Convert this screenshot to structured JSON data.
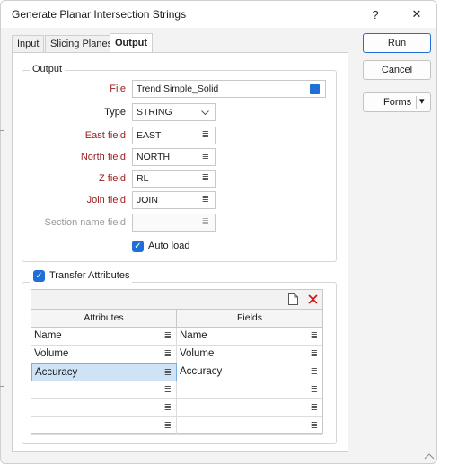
{
  "window": {
    "title": "Generate Planar Intersection Strings",
    "help": "?",
    "close": "✕"
  },
  "tabs": [
    {
      "label": "Input"
    },
    {
      "label": "Slicing Planes"
    },
    {
      "label": "Output"
    }
  ],
  "output": {
    "group_label": "Output",
    "file": {
      "label": "File",
      "value": "Trend Simple_Solid"
    },
    "type": {
      "label": "Type",
      "value": "STRING"
    },
    "east": {
      "label": "East field",
      "value": "EAST"
    },
    "north": {
      "label": "North field",
      "value": "NORTH"
    },
    "z": {
      "label": "Z field",
      "value": "RL"
    },
    "join": {
      "label": "Join field",
      "value": "JOIN"
    },
    "section": {
      "label": "Section name field",
      "value": ""
    },
    "auto_load": {
      "label": "Auto load",
      "checked": true
    }
  },
  "transfer": {
    "label": "Transfer Attributes",
    "checked": true,
    "columns": [
      "Attributes",
      "Fields"
    ],
    "rows": [
      {
        "attribute": "Name",
        "field": "Name"
      },
      {
        "attribute": "Volume",
        "field": "Volume"
      },
      {
        "attribute": "Accuracy",
        "field": "Accuracy"
      },
      {
        "attribute": "",
        "field": ""
      },
      {
        "attribute": "",
        "field": ""
      },
      {
        "attribute": "",
        "field": ""
      }
    ]
  },
  "buttons": {
    "run": "Run",
    "cancel": "Cancel",
    "forms": "Forms",
    "forms_dropdown": "▾"
  },
  "colors": {
    "accent": "#1f6fd6",
    "required_label": "#9b1c1c",
    "selected_row": "#cfe3f7"
  }
}
